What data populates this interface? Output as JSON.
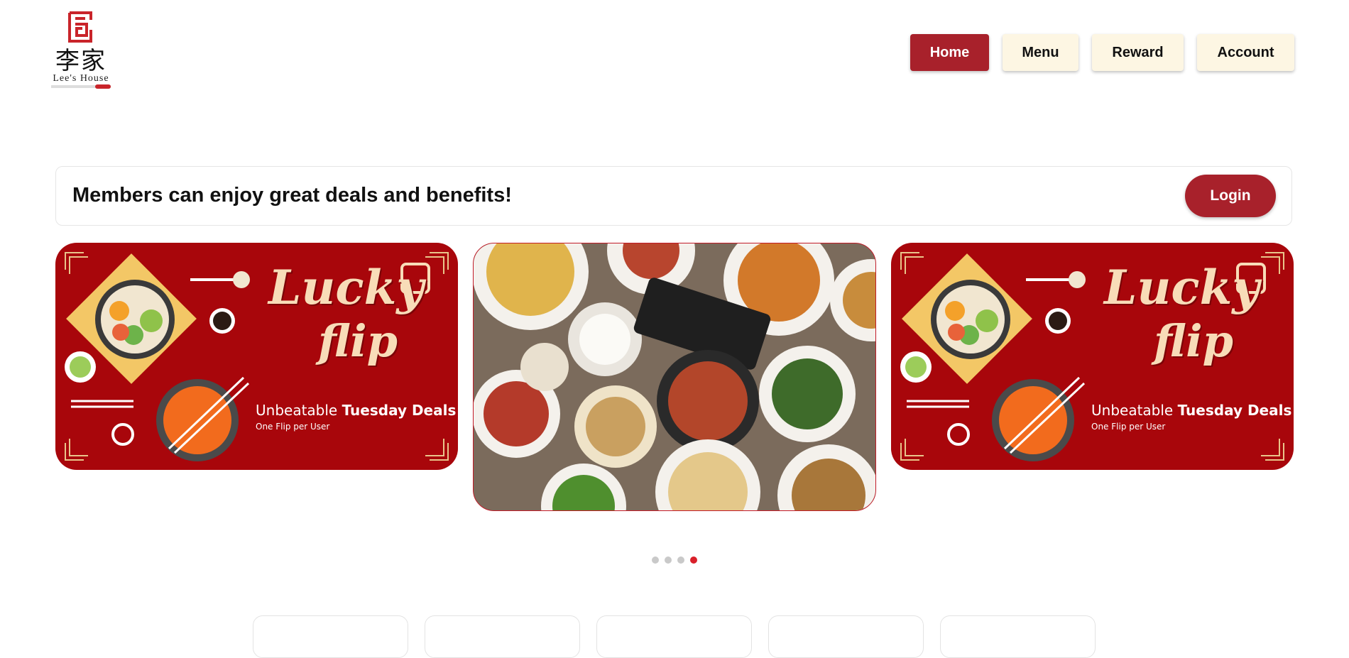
{
  "brand": {
    "name_cn": "李家",
    "name_en": "Lee's House",
    "primary_color": "#a8212b",
    "cream_color": "#fdf6e3"
  },
  "nav": {
    "items": [
      {
        "label": "Home",
        "active": true
      },
      {
        "label": "Menu",
        "active": false
      },
      {
        "label": "Reward",
        "active": false
      },
      {
        "label": "Account",
        "active": false
      }
    ]
  },
  "members": {
    "message": "Members can enjoy great deals and benefits!",
    "login_label": "Login"
  },
  "carousel": {
    "slides": [
      {
        "type": "promo",
        "title_line1": "Lucky",
        "title_line2": "flip",
        "deal_prefix": "Unbeatable ",
        "deal_bold": "Tuesday Deals",
        "subtitle": "One Flip per User"
      },
      {
        "type": "photo",
        "description_icon": "food-spread-image"
      },
      {
        "type": "promo",
        "title_line1": "Lucky",
        "title_line2": "flip",
        "deal_prefix": "Unbeatable ",
        "deal_bold": "Tuesday Deals",
        "subtitle": "One Flip per User"
      }
    ],
    "dot_count": 4,
    "active_dot": 4
  },
  "category_cards_count": 5
}
